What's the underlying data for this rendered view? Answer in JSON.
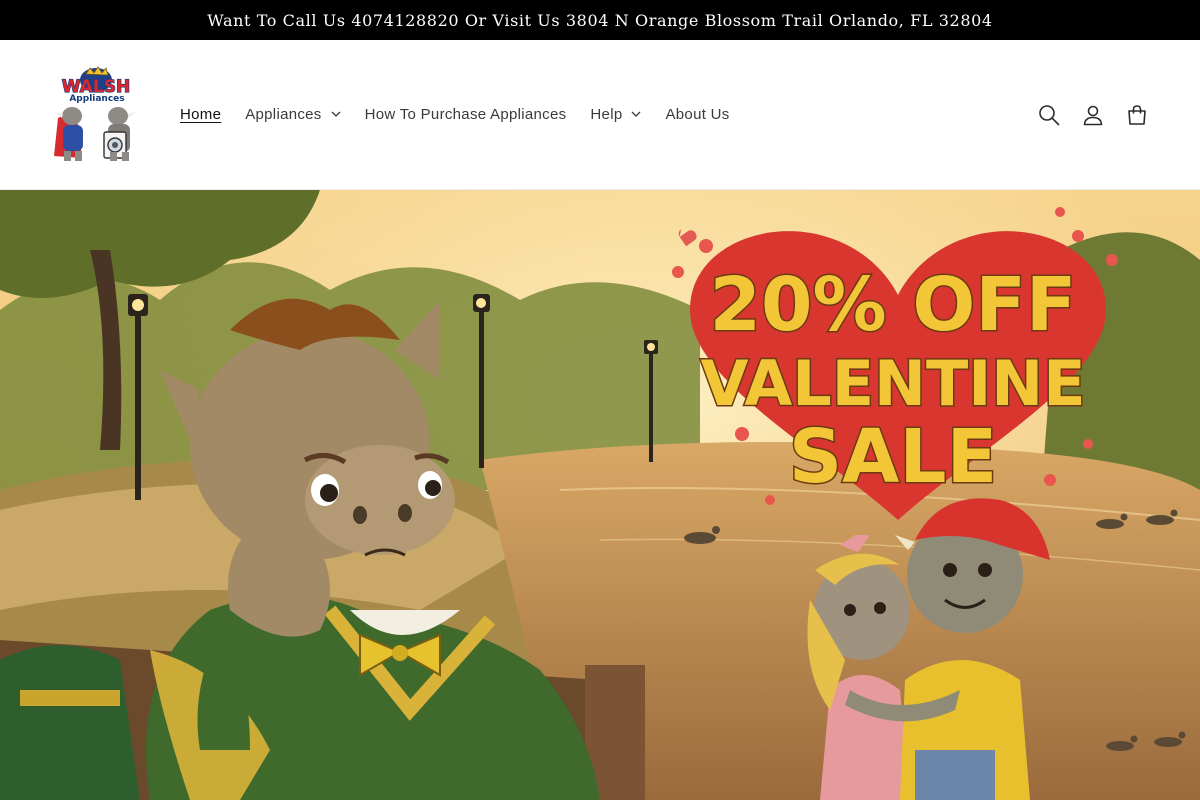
{
  "announcement": {
    "text": "Want To Call Us 4074128820 Or Visit Us 3804 N Orange Blossom Trail Orlando, FL 32804"
  },
  "header": {
    "logo": {
      "brand": "WALSH",
      "subtitle": "Appliances"
    },
    "nav": [
      {
        "label": "Home",
        "active": true,
        "has_dropdown": false
      },
      {
        "label": "Appliances",
        "active": false,
        "has_dropdown": true
      },
      {
        "label": "How To Purchase Appliances",
        "active": false,
        "has_dropdown": false
      },
      {
        "label": "Help",
        "active": false,
        "has_dropdown": true
      },
      {
        "label": "About Us",
        "active": false,
        "has_dropdown": false
      }
    ],
    "icons": [
      "search-icon",
      "account-icon",
      "cart-icon"
    ]
  },
  "hero": {
    "sale_line_1": "20% OFF",
    "sale_line_2": "VALENTINE",
    "sale_line_3": "SALE",
    "colors": {
      "heart": "#d8362f",
      "text_fill": "#f2c636",
      "text_outline": "#6b3a12",
      "sky": "#f3c77a",
      "water": "#c98f52"
    }
  }
}
